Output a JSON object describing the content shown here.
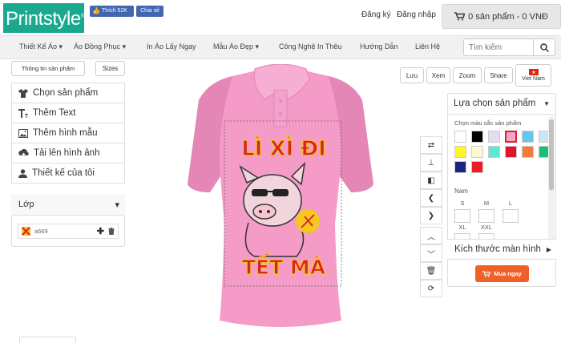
{
  "brand": {
    "logo_text": "Printstyle",
    "logo_reg": "®"
  },
  "facebook": {
    "like_label": "Thích 52K",
    "share_label": "Chia sẻ"
  },
  "header": {
    "register": "Đăng ký",
    "login": "Đăng nhập",
    "cart": "0 sản phẩm - 0 VNĐ"
  },
  "nav": {
    "items": [
      {
        "label": "Thiết Kế Áo",
        "caret": "▾"
      },
      {
        "label": "Áo Đồng Phục",
        "caret": "▾"
      },
      {
        "label": "In Áo Lấy Ngay",
        "caret": ""
      },
      {
        "label": "Mẫu Áo Đẹp",
        "caret": "▾"
      },
      {
        "label": "Công Nghệ In Thêu",
        "caret": ""
      },
      {
        "label": "Hướng Dẫn",
        "caret": ""
      },
      {
        "label": "Liên Hệ",
        "caret": ""
      }
    ],
    "search_placeholder": "Tìm kiếm"
  },
  "left_panel": {
    "tab_info": "Thông tin sản phẩm",
    "tab_sizes": "Sizes",
    "menu": [
      {
        "label": "Chọn sản phẩm",
        "icon": "shirt-icon"
      },
      {
        "label": "Thêm Text",
        "icon": "text-icon"
      },
      {
        "label": "Thêm hình mẫu",
        "icon": "image-icon"
      },
      {
        "label": "Tải lên hình ảnh",
        "icon": "cloud-upload-icon"
      },
      {
        "label": "Thiết kế của tôi",
        "icon": "user-icon"
      }
    ],
    "layers_title": "Lớp",
    "layers_caret": "▾",
    "layer_name": "a669"
  },
  "design": {
    "line1": "LÌ XÌ ĐI",
    "line2": "TẾT MÀ",
    "shirt_color": "#f49bc8",
    "accent_red": "#d8232a",
    "accent_yellow": "#f6c623"
  },
  "top_actions": {
    "save": "Lưu",
    "view": "Xem",
    "zoom": "Zoom",
    "share": "Share",
    "language": "Viet Nam"
  },
  "right_panel": {
    "dropdown_label": "Lựa chọn sản phẩm",
    "color_title": "Chọn màu sắc sản phẩm",
    "colors": [
      "#ffffff",
      "#000000",
      "#e6dcf2",
      "#f4a5c8",
      "#63c7ec",
      "#cbe4f6",
      "#fff52a",
      "#fbf9d2",
      "#5fe7d6",
      "#e0142b",
      "#f27b3d",
      "#18c07a",
      "#1a237e",
      "#ec1c24"
    ],
    "selected_color": "#f4a5c8",
    "gender_label": "Nam",
    "sizes_row1": [
      "S",
      "M",
      "L"
    ],
    "sizes_row2": [
      "XL",
      "XXL"
    ],
    "screen_size_label": "Kích thước màn hình",
    "buy_label": "Mua ngay"
  }
}
